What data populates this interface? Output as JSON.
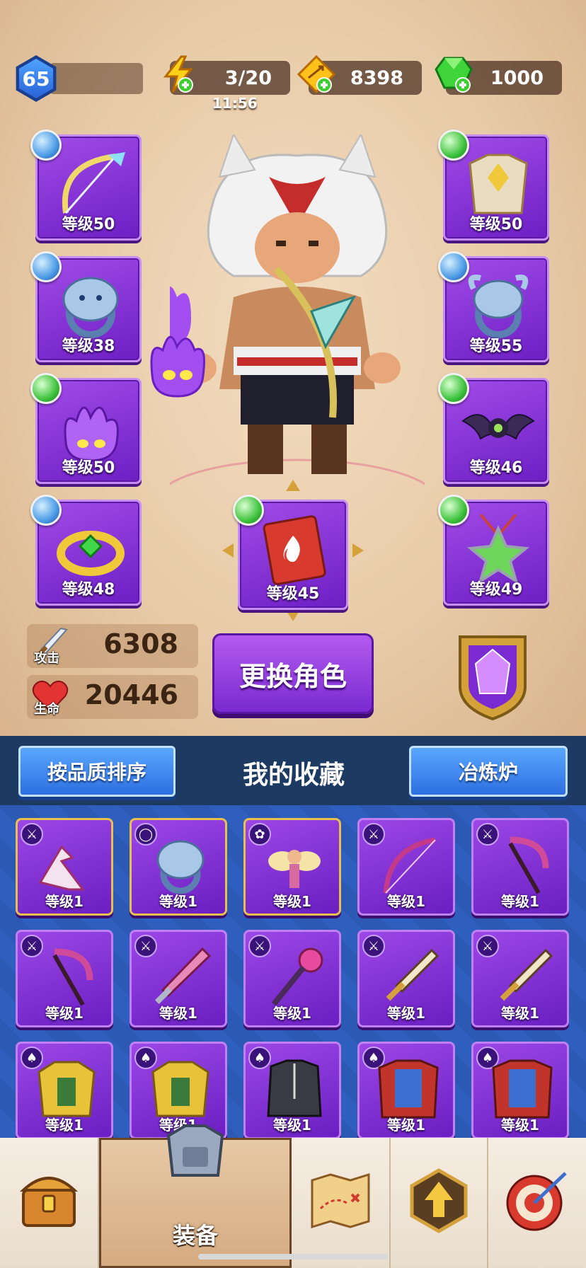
{
  "top_bar": {
    "player_level": "65",
    "energy": "3/20",
    "energy_timer": "11:56",
    "gold": "8398",
    "gems": "1000"
  },
  "equipment": {
    "left": [
      {
        "level": "等级50",
        "gem": "blue",
        "icon": "bow-icon"
      },
      {
        "level": "等级38",
        "gem": "blue",
        "icon": "lion-ring-icon"
      },
      {
        "level": "等级50",
        "gem": "green",
        "icon": "purple-spirit-icon"
      },
      {
        "level": "等级48",
        "gem": "blue",
        "icon": "gold-ring-icon"
      }
    ],
    "right": [
      {
        "level": "等级50",
        "gem": "green",
        "icon": "chest-armor-icon"
      },
      {
        "level": "等级55",
        "gem": "blue",
        "icon": "bull-ring-icon"
      },
      {
        "level": "等级46",
        "gem": "green",
        "icon": "bat-icon"
      },
      {
        "level": "等级49",
        "gem": "green",
        "icon": "star-amulet-icon"
      }
    ],
    "center": {
      "level": "等级45",
      "gem": "green",
      "icon": "fire-book-icon"
    }
  },
  "stats": {
    "attack_label": "攻击",
    "attack_value": "6308",
    "hp_label": "生命",
    "hp_value": "20446"
  },
  "change_hero_label": "更换角色",
  "collection": {
    "sort_label": "按品质排序",
    "title": "我的收藏",
    "forge_label": "冶炼炉"
  },
  "items": [
    {
      "level": "等级1",
      "type": "weapon",
      "icon": "boomerang-icon"
    },
    {
      "level": "等级1",
      "type": "ring",
      "icon": "lion-ring-icon"
    },
    {
      "level": "等级1",
      "type": "pet",
      "icon": "fairy-icon"
    },
    {
      "level": "等级1",
      "type": "weapon",
      "icon": "bow-icon"
    },
    {
      "level": "等级1",
      "type": "weapon",
      "icon": "scythe-icon"
    },
    {
      "level": "等级1",
      "type": "weapon",
      "icon": "scythe-icon"
    },
    {
      "level": "等级1",
      "type": "weapon",
      "icon": "sword-icon"
    },
    {
      "level": "等级1",
      "type": "weapon",
      "icon": "staff-icon"
    },
    {
      "level": "等级1",
      "type": "weapon",
      "icon": "dagger-icon"
    },
    {
      "level": "等级1",
      "type": "weapon",
      "icon": "dagger-icon"
    },
    {
      "level": "等级1",
      "type": "armor",
      "icon": "gold-armor-icon"
    },
    {
      "level": "等级1",
      "type": "armor",
      "icon": "gold-armor-icon"
    },
    {
      "level": "等级1",
      "type": "armor",
      "icon": "robe-icon"
    },
    {
      "level": "等级1",
      "type": "armor",
      "icon": "cape-armor-icon"
    },
    {
      "level": "等级1",
      "type": "armor",
      "icon": "cape-armor-icon"
    }
  ],
  "nav": {
    "equip_label": "装备"
  }
}
